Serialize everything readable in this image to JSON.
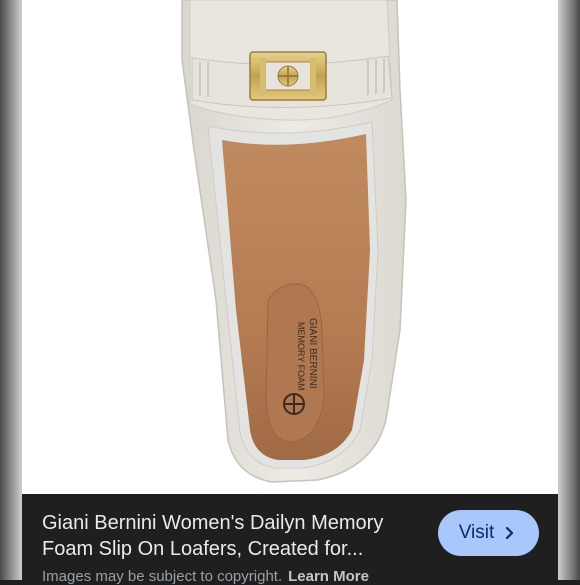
{
  "product": {
    "title_line1": "Giani Bernini Women's Dailyn Memory",
    "title_line2": "Foam Slip On Loafers, Created for..."
  },
  "visit_button": {
    "label": "Visit",
    "icon": "chevron-right-icon"
  },
  "notice": {
    "text": "Images may be subject to copyright.",
    "learn_more": "Learn More"
  },
  "insole_print": {
    "brand": "GIANI BERNINI",
    "subtitle": "MEMORY FOAM"
  },
  "colors": {
    "panel_bg": "#1f1f1f",
    "visit_bg": "#a8c7fa",
    "shoe": "#ece9e3",
    "insole": "#b98259",
    "hardware": "#c9a95a"
  }
}
